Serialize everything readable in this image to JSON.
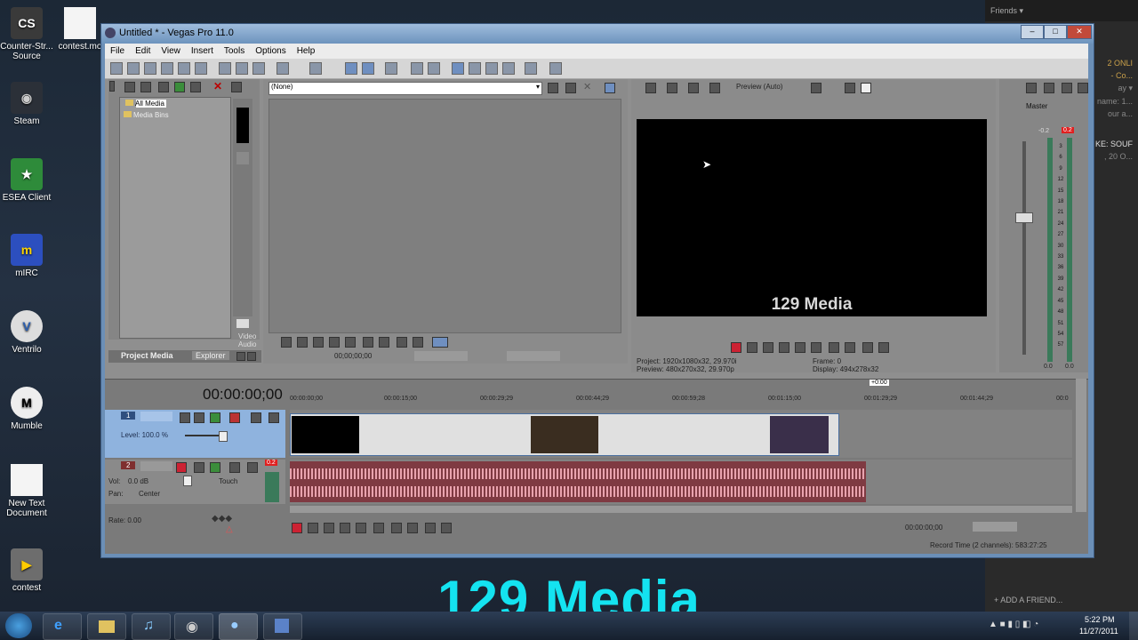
{
  "desktop": {
    "icons": [
      {
        "label": "Counter-Str... Source"
      },
      {
        "label": "contest.mo"
      },
      {
        "label": "Steam"
      },
      {
        "label": "ESEA Client"
      },
      {
        "label": "mIRC"
      },
      {
        "label": "Ventrilo"
      },
      {
        "label": "Mumble"
      },
      {
        "label": "New Text Document"
      },
      {
        "label": "contest"
      }
    ]
  },
  "friends": {
    "header": "Friends ▾",
    "rows": [
      "2 ONLI",
      "- Co...",
      "ay ▾",
      "name: 1...",
      "our a...",
      "KE: SOUF",
      ", 20 O..."
    ],
    "add_friend": "+ ADD A FRIEND..."
  },
  "window": {
    "title": "Untitled * - Vegas Pro 11.0",
    "menu": [
      "File",
      "Edit",
      "View",
      "Insert",
      "Tools",
      "Options",
      "Help"
    ],
    "explorer": {
      "tree": [
        "All Media",
        "Media Bins"
      ],
      "side_labels": [
        "Video",
        "Audio"
      ],
      "tabs": [
        "Project Media",
        "Explorer"
      ]
    },
    "trimmer": {
      "dropdown": "(None)",
      "timecode": "00;00;00;00"
    },
    "preview": {
      "mode": "Preview (Auto)",
      "overlay": "129 Media",
      "project_label": "Project:",
      "project_value": "1920x1080x32, 29.970i",
      "preview_label": "Preview:",
      "preview_value": "480x270x32, 29.970p",
      "frame_label": "Frame:",
      "frame_value": "0",
      "display_label": "Display:",
      "display_value": "494x278x32"
    },
    "master": {
      "label": "Master",
      "peak": "0.2",
      "top_value": "-0.2",
      "scale": [
        "3",
        "6",
        "9",
        "12",
        "15",
        "18",
        "21",
        "24",
        "27",
        "30",
        "33",
        "36",
        "39",
        "42",
        "45",
        "48",
        "51",
        "54",
        "57"
      ],
      "bottom_left": "0.0",
      "bottom_right": "0.0"
    },
    "timeline": {
      "timecode": "00:00:00;00",
      "marker": "+0:00",
      "ruler": [
        "00:00:00;00",
        "00:00:15;00",
        "00:00:29;29",
        "00:00:44;29",
        "00:00:59;28",
        "00:01:15;00",
        "00:01:29;29",
        "00:01:44;29",
        "00:0"
      ],
      "video_track": {
        "number": "1",
        "level": "Level: 100.0 %"
      },
      "audio_track": {
        "number": "2",
        "vol": "Vol:",
        "vol_value": "0.0 dB",
        "mode": "Touch",
        "pan": "Pan:",
        "pan_value": "Center",
        "peak": "0.2"
      },
      "rate": "Rate: 0.00",
      "transport_time": "00:00:00;00",
      "record_time": "Record Time (2 channels): 583:27:25"
    }
  },
  "overlay_text": "129 Media",
  "taskbar": {
    "time": "5:22 PM",
    "date": "11/27/2011"
  }
}
